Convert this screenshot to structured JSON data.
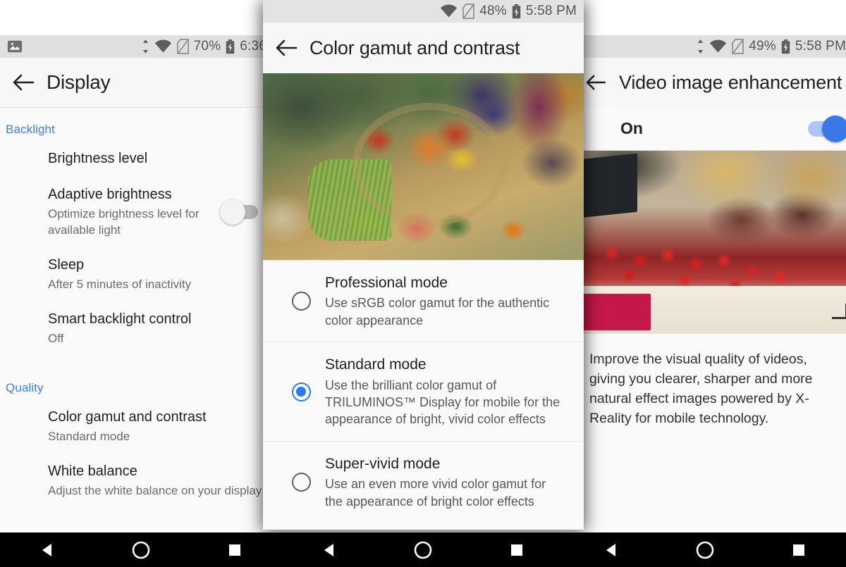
{
  "left_panel": {
    "statusbar": {
      "notification_icon": "image-icon",
      "data_icon": "data-transfer-icon",
      "wifi_icon": "wifi-icon",
      "sim_icon": "no-sim-icon",
      "battery_text": "70%",
      "battery_icon": "battery-charging-icon",
      "time": "6:36"
    },
    "appbar": {
      "back_icon": "back-arrow-icon",
      "title": "Display"
    },
    "sections": [
      {
        "header": "Backlight",
        "items": [
          {
            "title": "Brightness level",
            "subtitle": ""
          },
          {
            "title": "Adaptive brightness",
            "subtitle": "Optimize brightness level for\navailable light",
            "toggle": "off"
          },
          {
            "title": "Sleep",
            "subtitle": "After 5 minutes of inactivity"
          },
          {
            "title": "Smart backlight control",
            "subtitle": "Off"
          }
        ]
      },
      {
        "header": "Quality",
        "items": [
          {
            "title": "Color gamut and contrast",
            "subtitle": "Standard mode"
          },
          {
            "title": "White balance",
            "subtitle": "Adjust the white balance on your display"
          }
        ]
      }
    ]
  },
  "center_panel": {
    "statusbar": {
      "wifi_icon": "wifi-icon",
      "sim_icon": "no-sim-icon",
      "battery_text": "48%",
      "battery_icon": "battery-charging-icon",
      "time": "5:58 PM"
    },
    "appbar": {
      "back_icon": "back-arrow-icon",
      "title": "Color gamut and contrast"
    },
    "hero_image": "vegetable-basket-photo",
    "options": [
      {
        "title": "Professional mode",
        "subtitle": "Use sRGB color gamut for the authentic color appearance",
        "selected": false
      },
      {
        "title": "Standard mode",
        "subtitle": "Use the brilliant color gamut of TRILUMINOS™ Display for mobile for the appearance of bright, vivid color effects",
        "selected": true
      },
      {
        "title": "Super-vivid mode",
        "subtitle": "Use an even more vivid color gamut for the appearance of bright color effects",
        "selected": false
      }
    ]
  },
  "right_panel": {
    "statusbar": {
      "data_icon": "data-transfer-icon",
      "wifi_icon": "wifi-icon",
      "sim_icon": "no-sim-icon",
      "battery_text": "49%",
      "battery_icon": "battery-charging-icon",
      "time": "5:58 PM"
    },
    "appbar": {
      "back_icon": "back-arrow-icon",
      "title": "Video image enhancement"
    },
    "switch_row": {
      "label": "On",
      "state": "on"
    },
    "hero_image": "cherry-tomatoes-market-photo",
    "description": "Improve the visual quality of videos, giving you clearer, sharper and more natural effect images powered by X-Reality for mobile technology."
  },
  "navbar": {
    "groups": [
      {
        "back": "back-triangle-icon",
        "home": "home-circle-icon",
        "recents": "recents-square-icon"
      },
      {
        "back": "back-triangle-icon",
        "home": "home-circle-icon",
        "recents": "recents-square-icon"
      },
      {
        "back": "back-triangle-icon",
        "home": "home-circle-icon",
        "recents": "recents-square-icon"
      }
    ]
  },
  "colors": {
    "accent_blue": "#3d7ff4",
    "radio_selected": "#2a7bf0",
    "toggle_on": "#3b78e7",
    "statusbar_bg": "#e0e0e0",
    "panel_bg": "#fafafa"
  }
}
